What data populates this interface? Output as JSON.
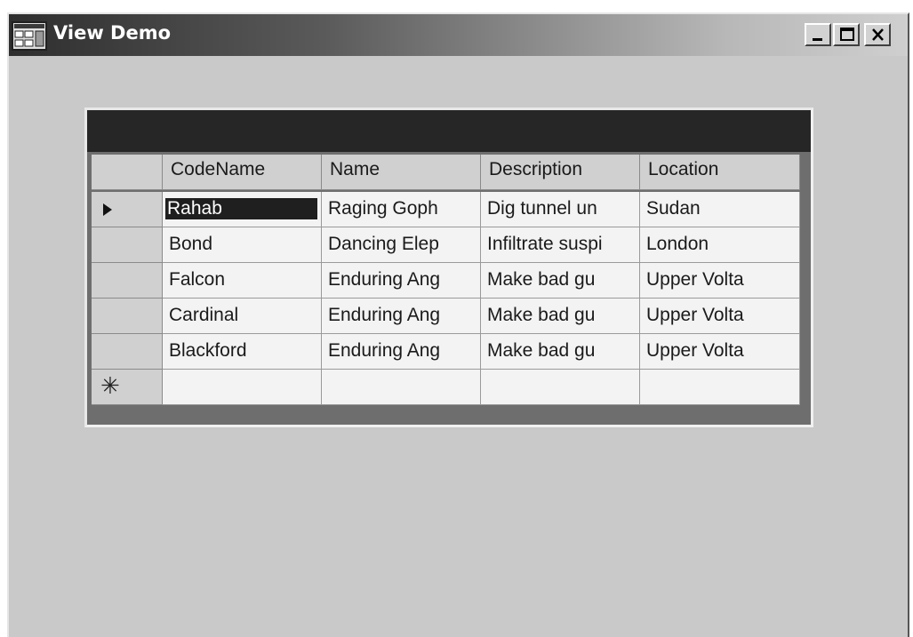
{
  "window": {
    "title": "View Demo",
    "icon": "app-window-icon",
    "controls": {
      "minimize": "minimize-icon",
      "maximize": "maximize-icon",
      "close": "close-icon"
    }
  },
  "grid": {
    "columns": [
      "CodeName",
      "Name",
      "Description",
      "Location"
    ],
    "rows": [
      {
        "cells": [
          "Rahab",
          "Raging Goph",
          "Dig tunnel un",
          "Sudan"
        ]
      },
      {
        "cells": [
          "Bond",
          "Dancing Elep",
          "Infiltrate suspi",
          "London"
        ]
      },
      {
        "cells": [
          "Falcon",
          "Enduring Ang",
          "Make bad gu",
          "Upper Volta"
        ]
      },
      {
        "cells": [
          "Cardinal",
          "Enduring Ang",
          "Make bad gu",
          "Upper Volta"
        ]
      },
      {
        "cells": [
          "Blackford",
          "Enduring Ang",
          "Make bad gu",
          "Upper Volta"
        ]
      }
    ],
    "current_row_indicator": "arrow-right-icon",
    "new_row_indicator": "✳",
    "selected_cell": {
      "row": 0,
      "col": 0
    }
  }
}
